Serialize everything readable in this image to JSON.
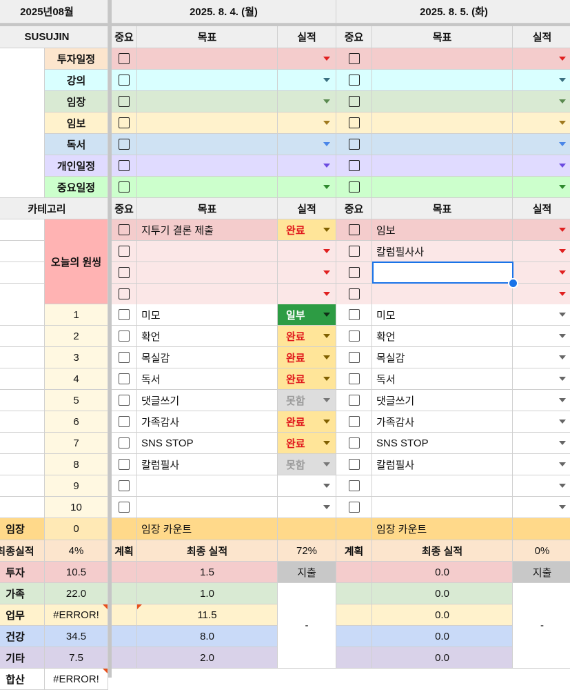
{
  "month_title": "2025년08월",
  "user_name": "SUSUJIN",
  "category_header": "카테고리",
  "days": [
    {
      "date": "2025. 8. 4. (월)"
    },
    {
      "date": "2025. 8. 5. (화)"
    }
  ],
  "col_headers": {
    "importance": "중요",
    "goal": "목표",
    "result": "실적"
  },
  "schedule_categories": [
    "투자일정",
    "강의",
    "임장",
    "임보",
    "독서",
    "개인일정",
    "중요일정"
  ],
  "schedule_colors": [
    "#f4cccc",
    "#d9ffff",
    "#d9ead3",
    "#fff2cc",
    "#cfe2f3",
    "#e0dbff",
    "#ccffcc"
  ],
  "label_colors": [
    "#fce5cd",
    "#d9ffff",
    "#d9ead3",
    "#fff2cc",
    "#cfe2f3",
    "#e0dbff",
    "#ccffcc"
  ],
  "arrow_colors": [
    "#e02020",
    "#3a6f80",
    "#5a8a50",
    "#a07a20",
    "#4a86e8",
    "#6b4be0",
    "#2e8a2e"
  ],
  "wish_label": "오늘의 원씽",
  "wish_rows": [
    {
      "d1_goal": "지투기 결론 제출",
      "d1_result": "완료",
      "d2_goal": "임보",
      "d2_result": ""
    },
    {
      "d1_goal": "",
      "d1_result": "",
      "d2_goal": "칼럼필사사",
      "d2_result": ""
    },
    {
      "d1_goal": "",
      "d1_result": "",
      "d2_goal": "",
      "d2_result": ""
    },
    {
      "d1_goal": "",
      "d1_result": "",
      "d2_goal": "",
      "d2_result": ""
    }
  ],
  "habits": [
    {
      "num": "1",
      "d1_goal": "미모",
      "d1_result": "일부",
      "d2_goal": "미모"
    },
    {
      "num": "2",
      "d1_goal": "확언",
      "d1_result": "완료",
      "d2_goal": "확언"
    },
    {
      "num": "3",
      "d1_goal": "목실감",
      "d1_result": "완료",
      "d2_goal": "목실감"
    },
    {
      "num": "4",
      "d1_goal": "독서",
      "d1_result": "완료",
      "d2_goal": "독서"
    },
    {
      "num": "5",
      "d1_goal": "댓글쓰기",
      "d1_result": "못함",
      "d2_goal": "댓글쓰기"
    },
    {
      "num": "6",
      "d1_goal": "가족감사",
      "d1_result": "완료",
      "d2_goal": "가족감사"
    },
    {
      "num": "7",
      "d1_goal": "SNS STOP",
      "d1_result": "완료",
      "d2_goal": "SNS STOP"
    },
    {
      "num": "8",
      "d1_goal": "칼럼필사",
      "d1_result": "못함",
      "d2_goal": "칼럼필사"
    },
    {
      "num": "9",
      "d1_goal": "",
      "d1_result": "",
      "d2_goal": ""
    },
    {
      "num": "10",
      "d1_goal": "",
      "d1_result": "",
      "d2_goal": ""
    }
  ],
  "imjang": {
    "label": "임장",
    "count": "0",
    "d1_text": "임장 카운트",
    "d2_text": "임장 카운트"
  },
  "final": {
    "label": "최종실적",
    "pct": "4%",
    "plan_label": "계획",
    "final_label": "최종 실적",
    "d1_pct": "72%",
    "d2_pct": "0%"
  },
  "stats": [
    {
      "label": "투자",
      "value": "10.5",
      "d1": "1.5",
      "d2": "0.0",
      "color": "#f4cccc"
    },
    {
      "label": "가족",
      "value": "22.0",
      "d1": "1.0",
      "d2": "0.0",
      "color": "#d9ead3"
    },
    {
      "label": "업무",
      "value": "#ERROR!",
      "d1": "11.5",
      "d2": "0.0",
      "color": "#fff2cc"
    },
    {
      "label": "건강",
      "value": "34.5",
      "d1": "8.0",
      "d2": "0.0",
      "color": "#c9daf8"
    },
    {
      "label": "기타",
      "value": "7.5",
      "d1": "2.0",
      "d2": "0.0",
      "color": "#d9d2e9"
    },
    {
      "label": "합산",
      "value": "#ERROR!",
      "d1": "",
      "d2": "",
      "color": "#ffffff"
    }
  ],
  "spend_label": "지출",
  "spend_value": "-"
}
